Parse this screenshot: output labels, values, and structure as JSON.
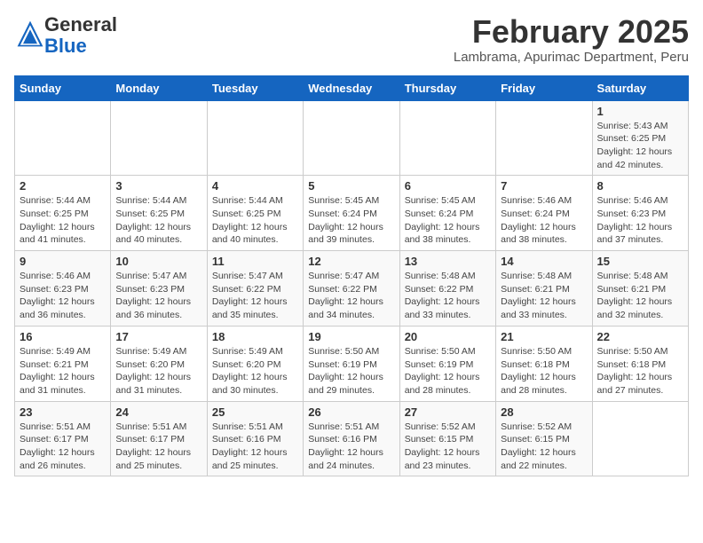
{
  "header": {
    "logo_general": "General",
    "logo_blue": "Blue",
    "month_title": "February 2025",
    "subtitle": "Lambrama, Apurimac Department, Peru"
  },
  "days_of_week": [
    "Sunday",
    "Monday",
    "Tuesday",
    "Wednesday",
    "Thursday",
    "Friday",
    "Saturday"
  ],
  "weeks": [
    {
      "days": [
        {
          "num": "",
          "info": ""
        },
        {
          "num": "",
          "info": ""
        },
        {
          "num": "",
          "info": ""
        },
        {
          "num": "",
          "info": ""
        },
        {
          "num": "",
          "info": ""
        },
        {
          "num": "",
          "info": ""
        },
        {
          "num": "1",
          "info": "Sunrise: 5:43 AM\nSunset: 6:25 PM\nDaylight: 12 hours and 42 minutes."
        }
      ]
    },
    {
      "days": [
        {
          "num": "2",
          "info": "Sunrise: 5:44 AM\nSunset: 6:25 PM\nDaylight: 12 hours and 41 minutes."
        },
        {
          "num": "3",
          "info": "Sunrise: 5:44 AM\nSunset: 6:25 PM\nDaylight: 12 hours and 40 minutes."
        },
        {
          "num": "4",
          "info": "Sunrise: 5:44 AM\nSunset: 6:25 PM\nDaylight: 12 hours and 40 minutes."
        },
        {
          "num": "5",
          "info": "Sunrise: 5:45 AM\nSunset: 6:24 PM\nDaylight: 12 hours and 39 minutes."
        },
        {
          "num": "6",
          "info": "Sunrise: 5:45 AM\nSunset: 6:24 PM\nDaylight: 12 hours and 38 minutes."
        },
        {
          "num": "7",
          "info": "Sunrise: 5:46 AM\nSunset: 6:24 PM\nDaylight: 12 hours and 38 minutes."
        },
        {
          "num": "8",
          "info": "Sunrise: 5:46 AM\nSunset: 6:23 PM\nDaylight: 12 hours and 37 minutes."
        }
      ]
    },
    {
      "days": [
        {
          "num": "9",
          "info": "Sunrise: 5:46 AM\nSunset: 6:23 PM\nDaylight: 12 hours and 36 minutes."
        },
        {
          "num": "10",
          "info": "Sunrise: 5:47 AM\nSunset: 6:23 PM\nDaylight: 12 hours and 36 minutes."
        },
        {
          "num": "11",
          "info": "Sunrise: 5:47 AM\nSunset: 6:22 PM\nDaylight: 12 hours and 35 minutes."
        },
        {
          "num": "12",
          "info": "Sunrise: 5:47 AM\nSunset: 6:22 PM\nDaylight: 12 hours and 34 minutes."
        },
        {
          "num": "13",
          "info": "Sunrise: 5:48 AM\nSunset: 6:22 PM\nDaylight: 12 hours and 33 minutes."
        },
        {
          "num": "14",
          "info": "Sunrise: 5:48 AM\nSunset: 6:21 PM\nDaylight: 12 hours and 33 minutes."
        },
        {
          "num": "15",
          "info": "Sunrise: 5:48 AM\nSunset: 6:21 PM\nDaylight: 12 hours and 32 minutes."
        }
      ]
    },
    {
      "days": [
        {
          "num": "16",
          "info": "Sunrise: 5:49 AM\nSunset: 6:21 PM\nDaylight: 12 hours and 31 minutes."
        },
        {
          "num": "17",
          "info": "Sunrise: 5:49 AM\nSunset: 6:20 PM\nDaylight: 12 hours and 31 minutes."
        },
        {
          "num": "18",
          "info": "Sunrise: 5:49 AM\nSunset: 6:20 PM\nDaylight: 12 hours and 30 minutes."
        },
        {
          "num": "19",
          "info": "Sunrise: 5:50 AM\nSunset: 6:19 PM\nDaylight: 12 hours and 29 minutes."
        },
        {
          "num": "20",
          "info": "Sunrise: 5:50 AM\nSunset: 6:19 PM\nDaylight: 12 hours and 28 minutes."
        },
        {
          "num": "21",
          "info": "Sunrise: 5:50 AM\nSunset: 6:18 PM\nDaylight: 12 hours and 28 minutes."
        },
        {
          "num": "22",
          "info": "Sunrise: 5:50 AM\nSunset: 6:18 PM\nDaylight: 12 hours and 27 minutes."
        }
      ]
    },
    {
      "days": [
        {
          "num": "23",
          "info": "Sunrise: 5:51 AM\nSunset: 6:17 PM\nDaylight: 12 hours and 26 minutes."
        },
        {
          "num": "24",
          "info": "Sunrise: 5:51 AM\nSunset: 6:17 PM\nDaylight: 12 hours and 25 minutes."
        },
        {
          "num": "25",
          "info": "Sunrise: 5:51 AM\nSunset: 6:16 PM\nDaylight: 12 hours and 25 minutes."
        },
        {
          "num": "26",
          "info": "Sunrise: 5:51 AM\nSunset: 6:16 PM\nDaylight: 12 hours and 24 minutes."
        },
        {
          "num": "27",
          "info": "Sunrise: 5:52 AM\nSunset: 6:15 PM\nDaylight: 12 hours and 23 minutes."
        },
        {
          "num": "28",
          "info": "Sunrise: 5:52 AM\nSunset: 6:15 PM\nDaylight: 12 hours and 22 minutes."
        },
        {
          "num": "",
          "info": ""
        }
      ]
    }
  ]
}
